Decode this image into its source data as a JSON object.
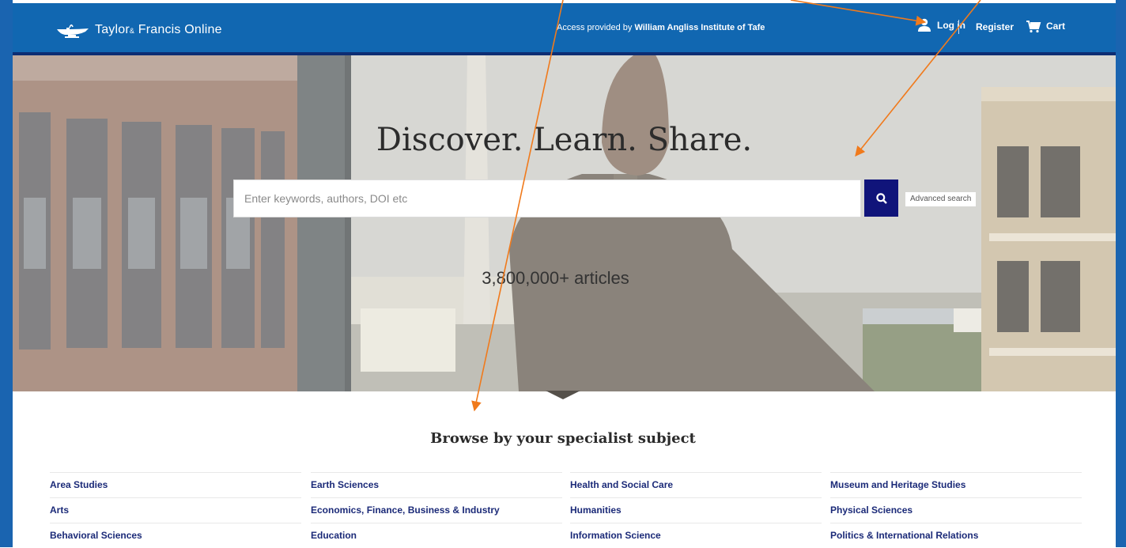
{
  "header": {
    "logo_text_main": "Taylor",
    "logo_text_amp": "&",
    "logo_text_tail": "Francis Online",
    "access_prefix": "Access provided by ",
    "access_institution": "William Angliss Institute of Tafe",
    "login_label": "Log in",
    "register_label": "Register",
    "cart_label": "Cart",
    "icons": [
      "lamp-logo-icon",
      "user-icon",
      "cart-icon"
    ]
  },
  "hero": {
    "title": "Discover. Learn. Share.",
    "search_placeholder": "Enter keywords, authors, DOI etc",
    "search_value": "",
    "search_icon": "search-icon",
    "advanced_search_label": "Advanced search",
    "article_count": "3,800,000+ articles"
  },
  "browse": {
    "title": "Browse by your specialist subject",
    "columns": [
      [
        "Area Studies",
        "Arts",
        "Behavioral Sciences"
      ],
      [
        "Earth Sciences",
        "Economics, Finance, Business & Industry",
        "Education"
      ],
      [
        "Health and Social Care",
        "Humanities",
        "Information Science"
      ],
      [
        "Museum and Heritage Studies",
        "Physical Sciences",
        "Politics & International Relations"
      ]
    ]
  },
  "colors": {
    "header_blue": "#1167b1",
    "header_rule": "#0d2d73",
    "search_button": "#10147a",
    "subject_link": "#1b2a78",
    "annotation_arrow": "#f07a1c"
  }
}
